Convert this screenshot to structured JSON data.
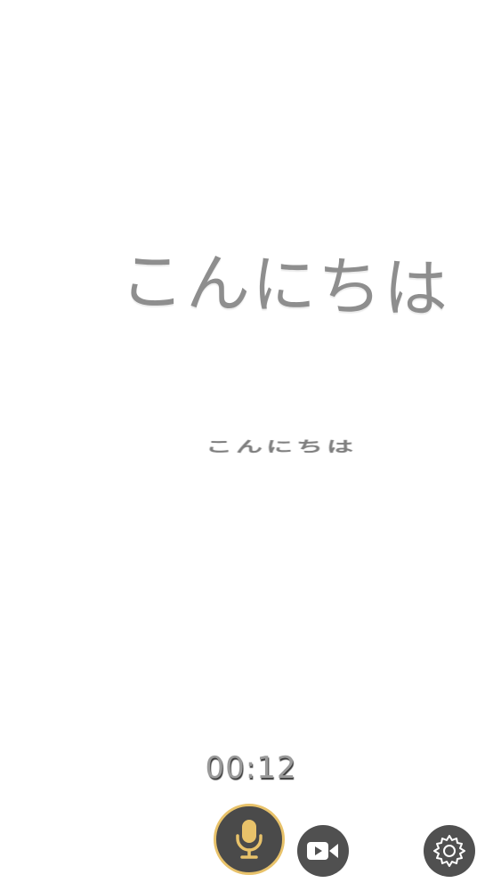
{
  "content": {
    "main_text": "こんにちは",
    "sub_text": "こんにちは"
  },
  "recorder": {
    "timer": "00:12"
  },
  "toolbar": {
    "mic_icon": "microphone-icon",
    "video_icon": "video-camera-icon",
    "settings_icon": "gear-icon"
  },
  "colors": {
    "mic_accent": "#e8c26a",
    "button_bg": "#4a4a4a",
    "text_gray": "#8e8e8e"
  }
}
